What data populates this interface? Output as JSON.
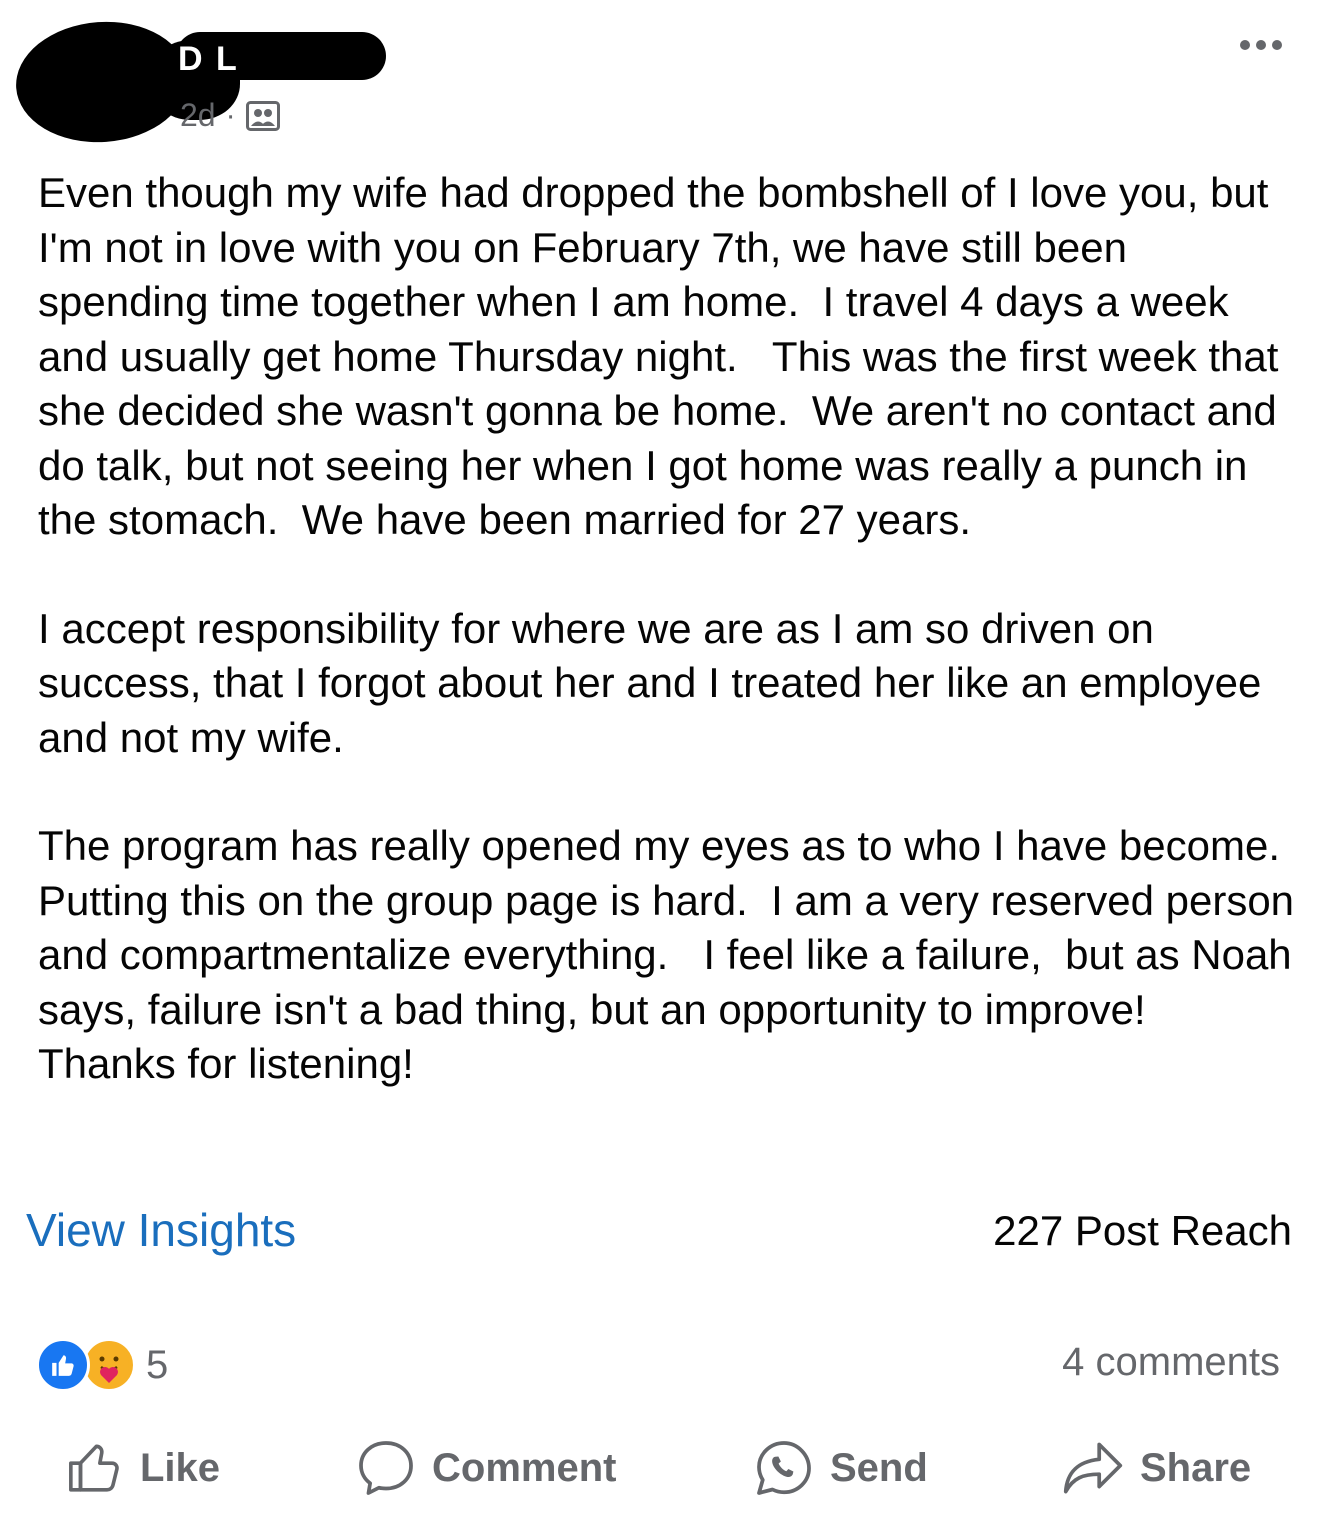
{
  "post": {
    "author_visible": "D  L",
    "time": "2d",
    "separator": "·",
    "audience_icon": "group-icon",
    "more_icon": "more-horizontal-icon",
    "paragraphs": [
      "Even though my wife had dropped the bombshell of I love you, but I'm not in love with you on February 7th, we have still been spending time together when I am home.  I travel 4 days a week and usually get home Thursday night.   This was the first week that she decided she wasn't gonna be home.  We aren't no contact and do talk, but not seeing her when I got home was really a punch in the stomach.  We have been married for 27 years.",
      "I accept responsibility for where we are as I am so driven on success, that I forgot about her and I treated her like an employee and not my wife.",
      "The program has really opened my eyes as to who I have become.   Putting this on the group page is hard.  I am a very reserved person and compartmentalize everything.   I feel like a failure,  but as Noah says, failure isn't a bad thing, but an opportunity to improve!  Thanks for listening!"
    ]
  },
  "insights": {
    "link_label": "View Insights",
    "reach_label": "227 Post Reach"
  },
  "engagement": {
    "reaction_icons": [
      "like-reaction-icon",
      "care-reaction-icon"
    ],
    "reaction_count": "5",
    "comments_label": "4 comments"
  },
  "actions": {
    "like": "Like",
    "comment": "Comment",
    "send": "Send",
    "share": "Share"
  },
  "colors": {
    "link": "#1a6ebd",
    "secondary_text": "#65676b",
    "like_blue": "#1877f2",
    "care_yellow": "#f7b125"
  }
}
